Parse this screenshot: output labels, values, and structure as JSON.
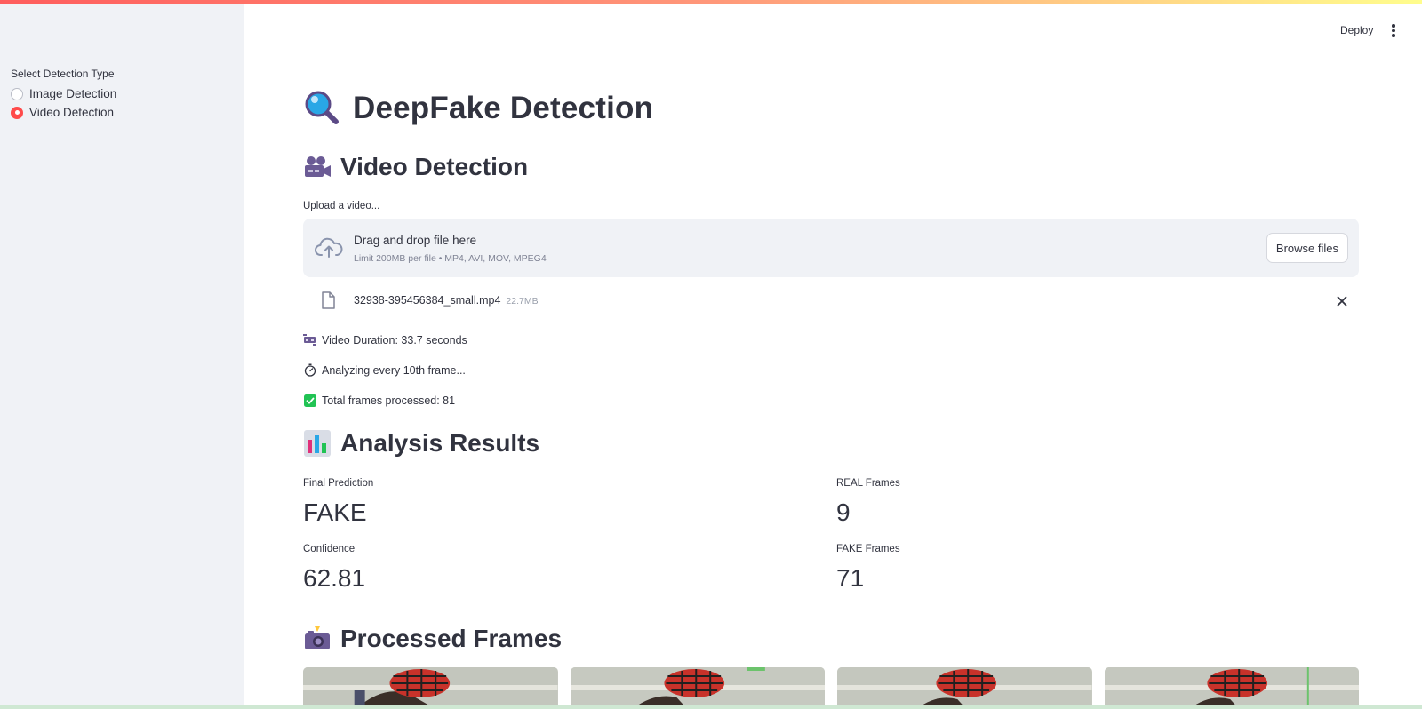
{
  "sidebar": {
    "label": "Select Detection Type",
    "options": [
      {
        "label": "Image Detection",
        "selected": false
      },
      {
        "label": "Video Detection",
        "selected": true
      }
    ]
  },
  "header": {
    "deploy_label": "Deploy"
  },
  "main": {
    "title": "DeepFake Detection",
    "video_heading": "Video Detection",
    "upload": {
      "label": "Upload a video...",
      "drop_title": "Drag and drop file here",
      "drop_sub": "Limit 200MB per file • MP4, AVI, MOV, MPEG4",
      "browse_label": "Browse files"
    },
    "file": {
      "name": "32938-395456384_small.mp4",
      "size": "22.7MB"
    },
    "status": {
      "duration": "Video Duration: 33.7 seconds",
      "analyzing": "Analyzing every 10th frame...",
      "total": "Total frames processed: 81"
    },
    "results_heading": "Analysis Results",
    "metrics": {
      "final_prediction": {
        "label": "Final Prediction",
        "value": "FAKE"
      },
      "real_frames": {
        "label": "REAL Frames",
        "value": "9"
      },
      "confidence": {
        "label": "Confidence",
        "value": "62.81"
      },
      "fake_frames": {
        "label": "FAKE Frames",
        "value": "71"
      }
    },
    "frames_heading": "Processed Frames"
  },
  "colors": {
    "accent": "#ff4b4b",
    "text": "#31333f",
    "sidebar_bg": "#f0f2f6"
  }
}
